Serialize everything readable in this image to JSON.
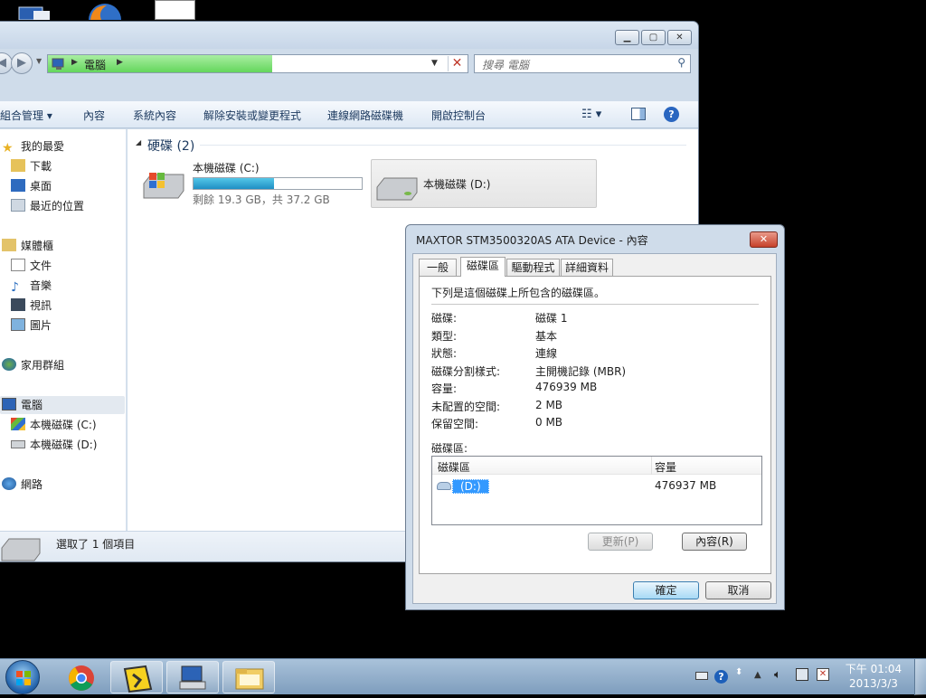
{
  "explorer": {
    "address": "電腦",
    "search_placeholder": "搜尋 電腦",
    "toolbar": [
      "組合管理",
      "內容",
      "系統內容",
      "解除安裝或變更程式",
      "連線網路磁碟機",
      "開啟控制台"
    ],
    "nav": {
      "favorites_header": "我的最愛",
      "favorites": [
        "下載",
        "桌面",
        "最近的位置"
      ],
      "libraries_header": "媒體櫃",
      "libraries": [
        "文件",
        "音樂",
        "視訊",
        "圖片"
      ],
      "homegroup": "家用群組",
      "computer": "電腦",
      "drives": [
        "本機磁碟 (C:)",
        "本機磁碟 (D:)"
      ],
      "network": "網路"
    },
    "section_title": "硬碟 (2)",
    "drive_c": {
      "name": "本機磁碟 (C:)",
      "free_text": "剩餘 19.3 GB，共 37.2 GB",
      "used_fraction": 0.48
    },
    "drive_d": {
      "name": "本機磁碟 (D:)"
    },
    "status_text": "選取了 1 個項目"
  },
  "dialog": {
    "title": "MAXTOR STM3500320AS ATA Device - 內容",
    "tabs": [
      "一般",
      "磁碟區",
      "驅動程式",
      "詳細資料"
    ],
    "active_tab": "磁碟區",
    "intro": "下列是這個磁碟上所包含的磁碟區。",
    "fields": [
      {
        "label": "磁碟:",
        "value": "磁碟 1"
      },
      {
        "label": "類型:",
        "value": "基本"
      },
      {
        "label": "狀態:",
        "value": "連線"
      },
      {
        "label": "磁碟分割樣式:",
        "value": "主開機記錄 (MBR)"
      },
      {
        "label": "容量:",
        "value": "476939 MB"
      },
      {
        "label": "未配置的空間:",
        "value": "2 MB"
      },
      {
        "label": "保留空間:",
        "value": "0 MB"
      }
    ],
    "volumes_label": "磁碟區:",
    "columns": [
      "磁碟區",
      "容量"
    ],
    "volumes": [
      {
        "name": "(D:)",
        "capacity": "476937 MB"
      }
    ],
    "refresh_button": "更新(P)",
    "properties_button": "內容(R)",
    "ok_button": "確定",
    "cancel_button": "取消"
  },
  "taskbar": {
    "time": "下午 01:04",
    "date": "2013/3/3"
  }
}
